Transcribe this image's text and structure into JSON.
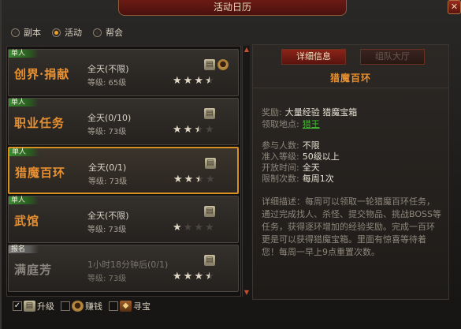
{
  "window": {
    "title": "活动日历",
    "close_glyph": "✕"
  },
  "category_tabs": [
    {
      "label": "副本",
      "selected": false
    },
    {
      "label": "活动",
      "selected": true
    },
    {
      "label": "帮会",
      "selected": false
    }
  ],
  "activities": [
    {
      "tag": "单人",
      "name": "创界·捐献",
      "time": "全天(不限)",
      "level": "等级: 65级",
      "stars": 3.5,
      "icons": [
        "book-icon",
        "coin-bag-icon"
      ],
      "selected": false,
      "dim": false
    },
    {
      "tag": "单人",
      "name": "职业任务",
      "time": "全天(0/10)",
      "level": "等级: 73级",
      "stars": 2.5,
      "icons": [
        "book-icon"
      ],
      "selected": false,
      "dim": false
    },
    {
      "tag": "单人",
      "name": "猎魔百环",
      "time": "全天(0/1)",
      "level": "等级: 73级",
      "stars": 2.5,
      "icons": [
        "book-icon"
      ],
      "selected": true,
      "dim": false
    },
    {
      "tag": "单人",
      "name": "武馆",
      "time": "全天(不限)",
      "level": "等级: 73级",
      "stars": 1,
      "icons": [
        "book-icon"
      ],
      "selected": false,
      "dim": false
    },
    {
      "tag": "报名",
      "name": "满庭芳",
      "time": "1小时18分钟后(0/1)",
      "level": "等级: 73级",
      "stars": 3.5,
      "icons": [
        "book-icon"
      ],
      "selected": false,
      "dim": true
    }
  ],
  "detail": {
    "tabs": [
      "详细信息",
      "组队大厅"
    ],
    "title": "猎魔百环",
    "reward_label": "奖励:",
    "reward_value": "大量经验 猎魔宝箱",
    "location_label": "领取地点:",
    "location_value": "猎王",
    "participants_label": "参与人数:",
    "participants_value": "不限",
    "level_label": "准入等级:",
    "level_value": "50级以上",
    "open_label": "开放时间:",
    "open_value": "全天",
    "limit_label": "限制次数:",
    "limit_value": "每周1次",
    "description": "详细描述：每周可以领取一轮猎魔百环任务，通过完成找人、杀怪、提交物品、挑战BOSS等任务，获得逐环增加的经验奖励。完成一百环更是可以获得猎魔宝箱。里面有惊喜等待着您！每周一早上9点重置次数。"
  },
  "filters": [
    {
      "label": "升级",
      "checked": true,
      "icon": "book-icon"
    },
    {
      "label": "赚钱",
      "checked": false,
      "icon": "coin-bag-icon"
    },
    {
      "label": "寻宝",
      "checked": false,
      "icon": "treasure-icon"
    }
  ]
}
